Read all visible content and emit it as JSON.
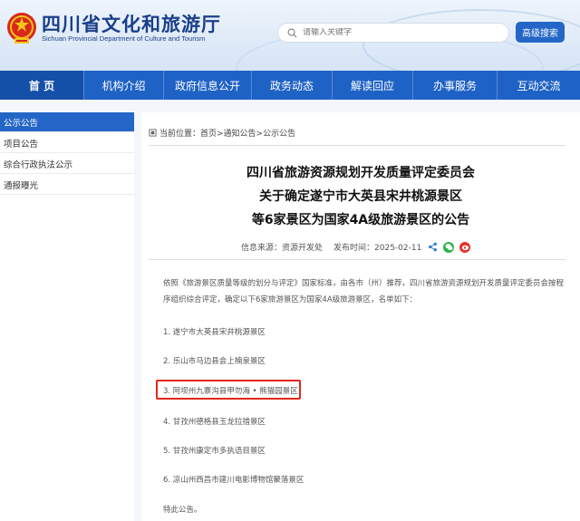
{
  "header": {
    "title": "四川省文化和旅游厅",
    "subtitle": "Sichuan Provincial Department of Culture and Tourism",
    "search_placeholder": "请输入关键字",
    "search_button": "高级搜索"
  },
  "nav": {
    "items": [
      "首 页",
      "机构介绍",
      "政府信息公开",
      "政务动态",
      "解读回应",
      "办事服务",
      "互动交流"
    ]
  },
  "sidebar": {
    "items": [
      "公示公告",
      "项目公告",
      "综合行政执法公示",
      "通报曝光"
    ]
  },
  "breadcrumb": {
    "prefix": "当前位置：",
    "path": "首页>通知公告>公示公告"
  },
  "article": {
    "title_lines": [
      "四川省旅游资源规划开发质量评定委员会",
      "关于确定遂宁市大英县宋井桃源景区",
      "等6家景区为国家4A级旅游景区的公告"
    ],
    "source_label": "信息来源：资源开发处",
    "date_label": "发布时间：2025-02-11",
    "intro": "依照《旅游景区质量等级的划分与评定》国家标准，由各市（州）推荐，四川省旅游资源规划开发质量评定委员会按程序组织综合评定，确定以下6家旅游景区为国家4A级旅游景区，名单如下：",
    "list": [
      "1. 遂宁市大英县宋井桃源景区",
      "2. 乐山市马边县会上楠泉景区",
      "3. 阿坝州九寨沟县甲勿海 • 熊猫园景区",
      "4. 甘孜州德格县玉龙拉措景区",
      "5. 甘孜州康定市多执语目景区",
      "6. 凉山州西昌市建川电影博物馆聚落景区"
    ],
    "closing": "特此公告。"
  },
  "colors": {
    "brand_blue": "#1f62c6",
    "highlight_red": "#e2261b"
  }
}
